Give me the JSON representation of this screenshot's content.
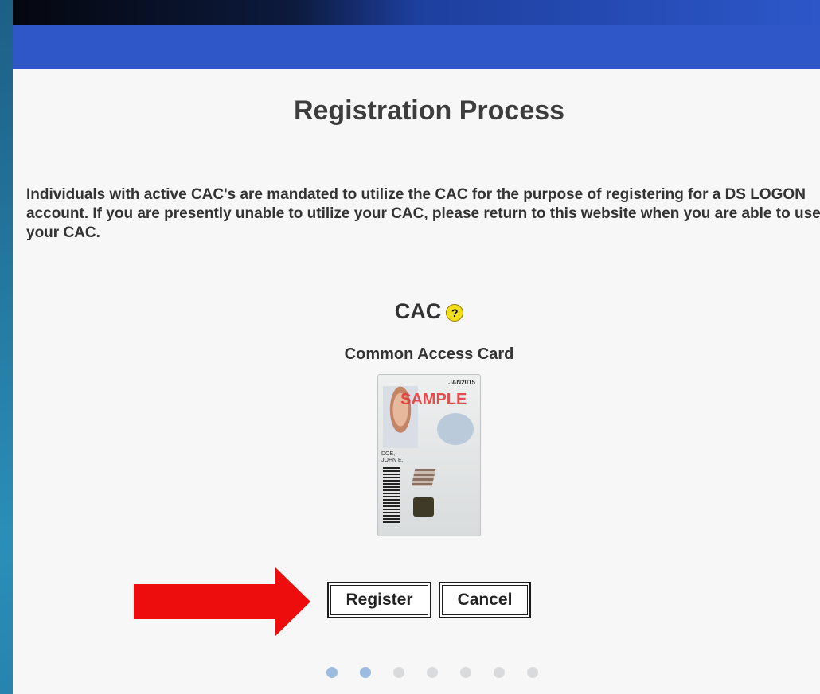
{
  "page": {
    "title": "Registration Process",
    "intro": "Individuals with active CAC's are mandated to utilize the CAC for the purpose of registering for a DS LOGON account. If you are presently unable to utilize your CAC, please return to this website when you are able to use your CAC."
  },
  "cac": {
    "heading": "CAC",
    "help_icon": "?",
    "subtitle": "Common Access Card",
    "card_date": "JAN2015",
    "card_watermark": "SAMPLE",
    "card_name_line1": "DOE,",
    "card_name_line2": "JOHN E."
  },
  "buttons": {
    "register": "Register",
    "cancel": "Cancel"
  },
  "progress": {
    "total_steps": 7,
    "completed_steps": 2
  },
  "colors": {
    "panel_bg": "#f7f7f7",
    "header_blue": "#3057c8",
    "arrow_red": "#ee0d0d",
    "help_icon_yellow": "#f2dd1d",
    "dot_active": "#9cbbe0",
    "dot_inactive": "#d9dadb"
  }
}
